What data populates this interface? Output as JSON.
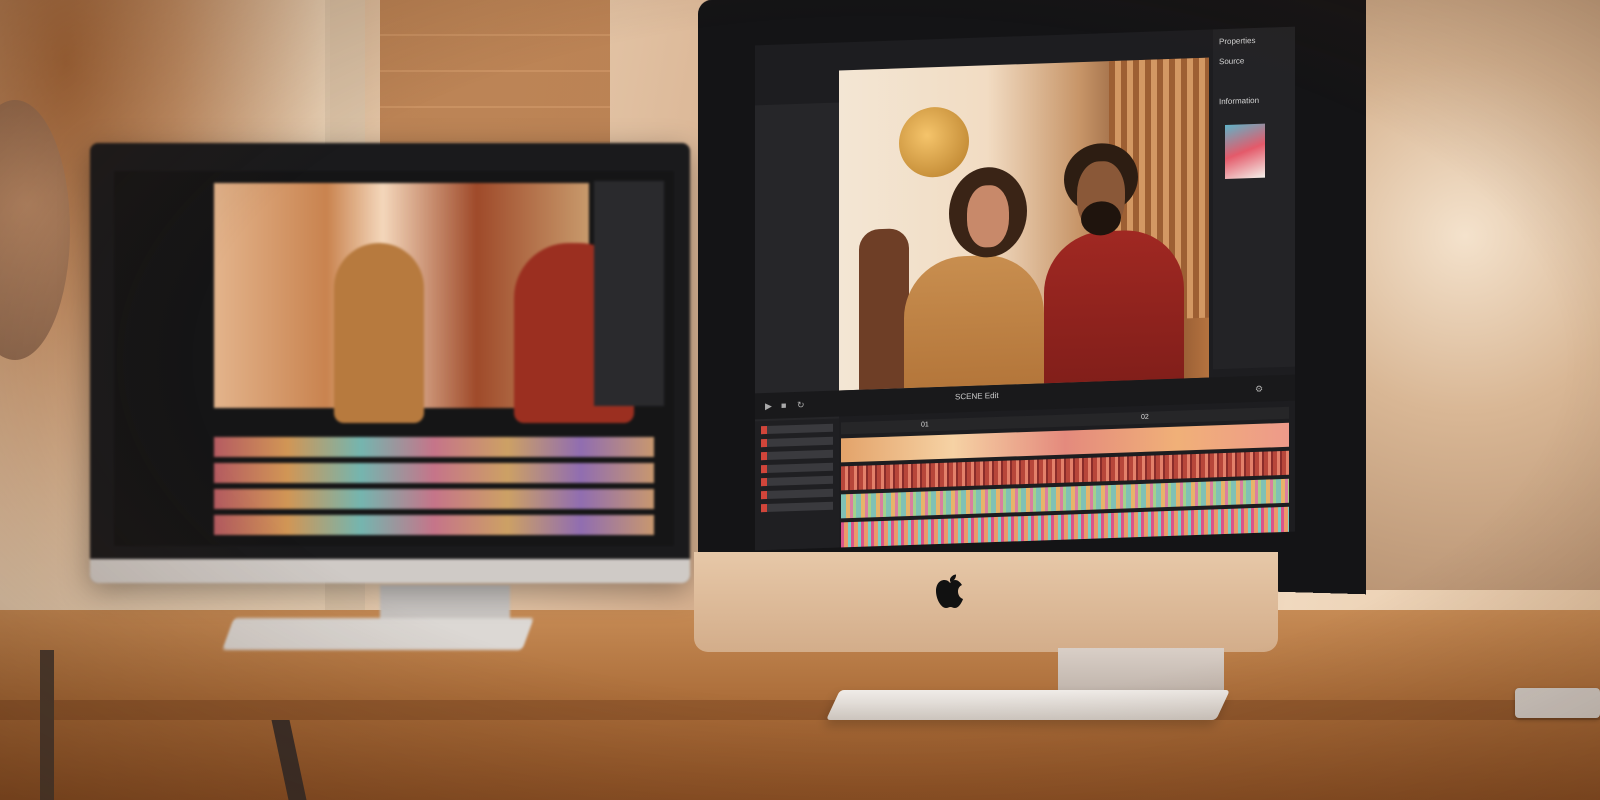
{
  "scene": {
    "description_label": "",
    "imac": {
      "app": {
        "inspector": {
          "header": "Properties",
          "rows": [
            "Source",
            "",
            "Information",
            ""
          ]
        },
        "toolbar": {
          "title": "SCENE Edit"
        },
        "ruler": {
          "marks": [
            "01",
            "02"
          ]
        }
      }
    }
  }
}
